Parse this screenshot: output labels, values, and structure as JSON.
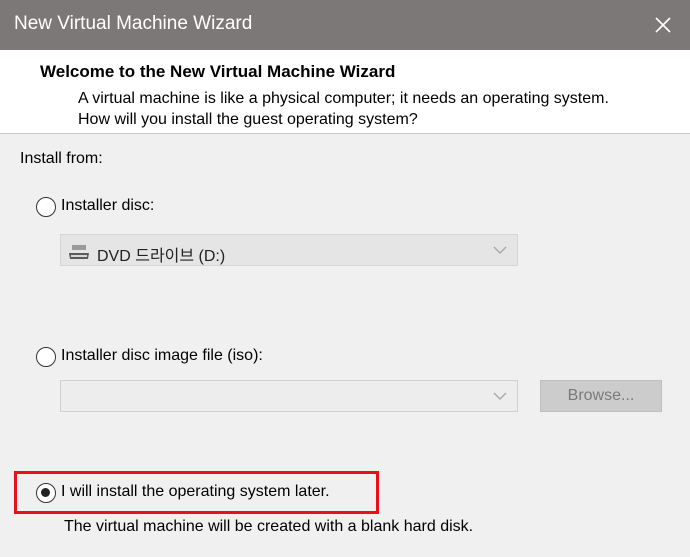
{
  "window": {
    "title": "New Virtual Machine Wizard"
  },
  "header": {
    "title": "Welcome to the New Virtual Machine Wizard",
    "description": "A virtual machine is like a physical computer; it needs an operating system. How will you install the guest operating system?"
  },
  "install_from": {
    "label": "Install from:",
    "options": [
      {
        "label": "Installer disc:",
        "selected": false
      },
      {
        "label": "Installer disc image file (iso):",
        "selected": false
      },
      {
        "label": "I will install the operating system later.",
        "selected": true
      }
    ],
    "disc_dropdown": {
      "value": "DVD 드라이브 (D:)",
      "icon": "dvd-drive-icon"
    },
    "iso_dropdown": {
      "value": ""
    },
    "browse_label": "Browse...",
    "later_note": "The virtual machine will be created with a blank hard disk."
  },
  "colors": {
    "titlebar": "#7d7878",
    "highlight": "#e8101b"
  }
}
